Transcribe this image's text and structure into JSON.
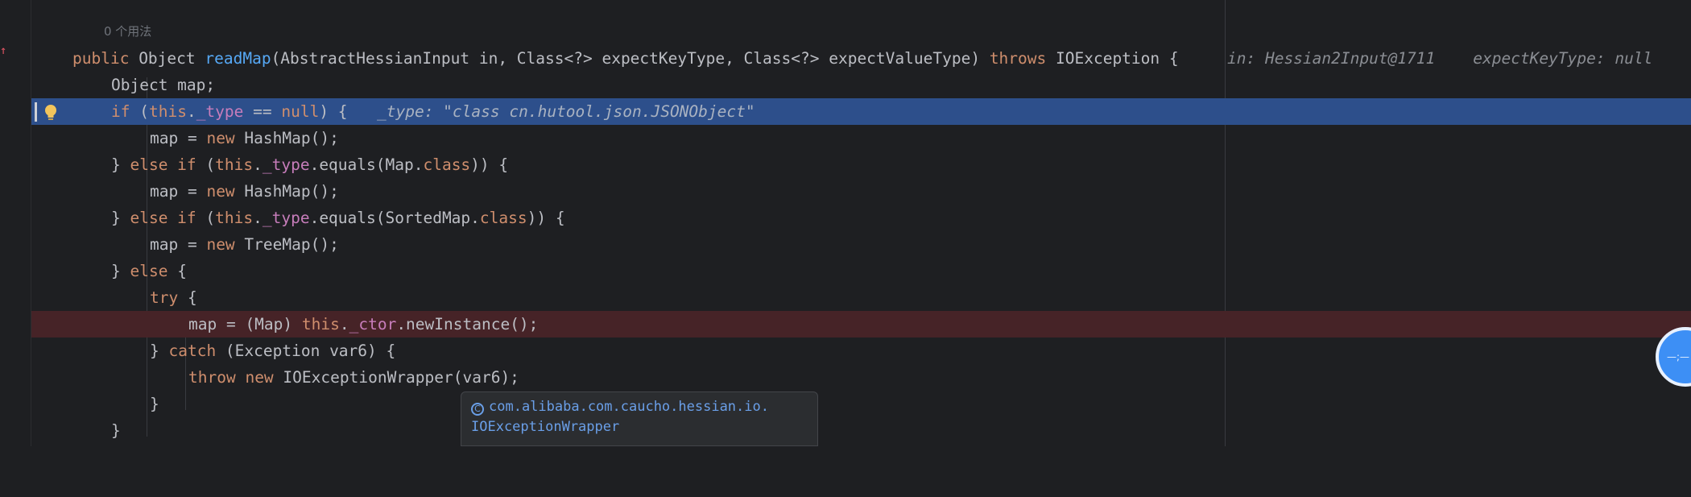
{
  "gutter": {
    "change_marker": "↑"
  },
  "usages_hint": "0 个用法",
  "tooltip": {
    "icon": "C",
    "line1": "com.alibaba.com.caucho.hessian.io.",
    "line2": "IOExceptionWrapper"
  },
  "fab": {
    "label": "—;—"
  },
  "code": {
    "l1": {
      "kw1": "public",
      "t1": " Object ",
      "fn": "readMap",
      "t2": "(AbstractHessianInput in, Class<?> expectKeyType, Class<?> expectValueType) ",
      "kw2": "throws",
      "t3": " IOException {",
      "hint": "in: Hessian2Input@1711    expectKeyType: null"
    },
    "l2": {
      "t1": "Object map;"
    },
    "l3": {
      "kw1": "if",
      "t1": " (",
      "kw2": "this",
      "t2": ".",
      "fld": "_type",
      "t3": " == ",
      "kw3": "null",
      "t4": ") {",
      "hint": "_type: \"class cn.hutool.json.JSONObject\""
    },
    "l4": {
      "t1": "map = ",
      "kw1": "new",
      "t2": " HashMap();"
    },
    "l5": {
      "t1": "} ",
      "kw1": "else if",
      "t2": " (",
      "kw2": "this",
      "t3": ".",
      "fld": "_type",
      "t4": ".equals(Map.",
      "kw3": "class",
      "t5": ")) {"
    },
    "l6": {
      "t1": "map = ",
      "kw1": "new",
      "t2": " HashMap();"
    },
    "l7": {
      "t1": "} ",
      "kw1": "else if",
      "t2": " (",
      "kw2": "this",
      "t3": ".",
      "fld": "_type",
      "t4": ".equals(SortedMap.",
      "kw3": "class",
      "t5": ")) {"
    },
    "l8": {
      "t1": "map = ",
      "kw1": "new",
      "t2": " TreeMap();"
    },
    "l9": {
      "t1": "} ",
      "kw1": "else",
      "t2": " {"
    },
    "l10": {
      "kw1": "try",
      "t1": " {"
    },
    "l11": {
      "t1": "map = (Map) ",
      "kw1": "this",
      "t2": ".",
      "fld": "_ctor",
      "t3": ".newInstance();"
    },
    "l12": {
      "t1": "} ",
      "kw1": "catch",
      "t2": " (Exception var6) {"
    },
    "l13": {
      "kw1": "throw",
      "t1": " ",
      "kw2": "new",
      "t2": " IOExceptionWrapper(var6);"
    },
    "l14": {
      "t1": "}"
    },
    "l15": {
      "t1": "}"
    }
  }
}
